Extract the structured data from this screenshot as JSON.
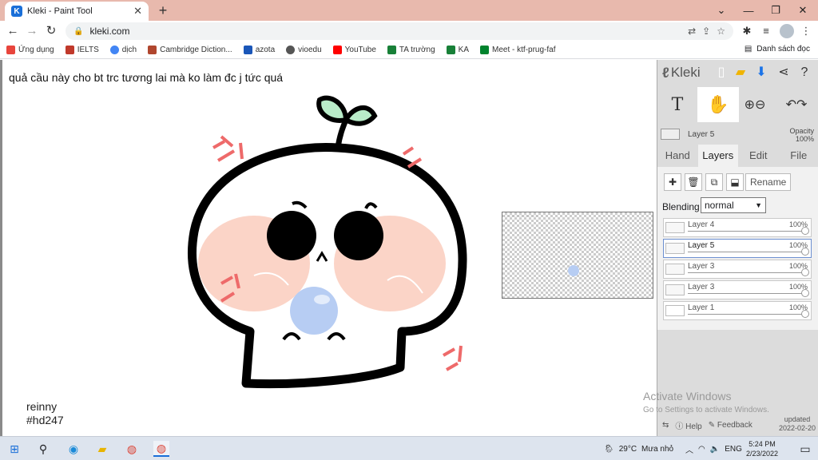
{
  "browser": {
    "tab_title": "Kleki - Paint Tool",
    "tab_close": "✕",
    "new_tab": "+",
    "url": "kleki.com",
    "window_controls": [
      "⌄",
      "—",
      "❐",
      "✕"
    ],
    "bookmarks": [
      {
        "label": "Ứng dụng",
        "color": "#e8453c"
      },
      {
        "label": "IELTS",
        "color": "#c0392b"
      },
      {
        "label": "dịch",
        "color": "#4285f4"
      },
      {
        "label": "Cambridge Diction...",
        "color": "#b0462e"
      },
      {
        "label": "azota",
        "color": "#1a56b8"
      },
      {
        "label": "vioedu",
        "color": "#555555"
      },
      {
        "label": "YouTube",
        "color": "#ff0000"
      },
      {
        "label": "TA trường",
        "color": "#188038"
      },
      {
        "label": "KA",
        "color": "#188038"
      },
      {
        "label": "Meet - ktf-prug-faf",
        "color": "#00832d"
      }
    ],
    "reading_list": "Danh sách đọc"
  },
  "canvas": {
    "caption": "quả cầu này cho bt trc tương lai mà ko làm đc j tức quá",
    "signature_line1": "reinny",
    "signature_line2": "#hd247"
  },
  "panel": {
    "logo": "Kleki",
    "current_layer": "Layer 5",
    "opacity_label": "Opacity",
    "opacity_value": "100%",
    "tabs": [
      "Hand",
      "Layers",
      "Edit",
      "File"
    ],
    "active_tab": "Layers",
    "rename_label": "Rename",
    "blending_label": "Blending",
    "blending_value": "normal",
    "layers": [
      {
        "name": "Layer 4",
        "opacity": "100%",
        "selected": false
      },
      {
        "name": "Layer 5",
        "opacity": "100%",
        "selected": true
      },
      {
        "name": "Layer 3",
        "opacity": "100%",
        "selected": false
      },
      {
        "name": "Layer 3",
        "opacity": "100%",
        "selected": false
      },
      {
        "name": "Layer 1",
        "opacity": "100%",
        "selected": false
      }
    ],
    "help_label": "Help",
    "feedback_label": "Feedback",
    "updated_label": "updated",
    "updated_date": "2022-02-20"
  },
  "os": {
    "activate_title": "Activate Windows",
    "activate_subtitle": "Go to Settings to activate Windows.",
    "weather_temp": "29°C",
    "weather_text": "Mưa nhỏ",
    "language": "ENG",
    "time": "5:24 PM",
    "date": "2/23/2022"
  }
}
